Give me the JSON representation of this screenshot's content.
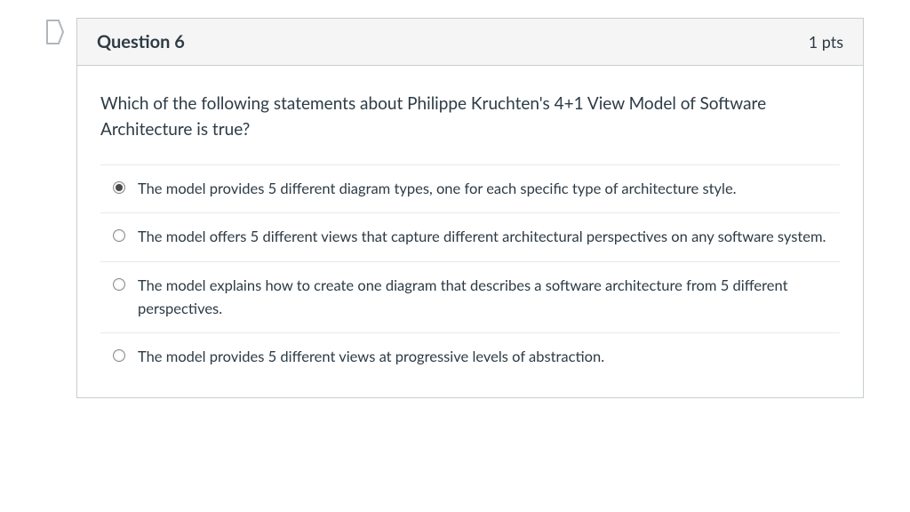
{
  "header": {
    "title": "Question 6",
    "points": "1 pts"
  },
  "prompt": "Which of the following statements about Philippe Kruchten's 4+1 View Model of Software Architecture is true?",
  "options": [
    {
      "text": "The model provides 5 different diagram types, one for each specific type of architecture style.",
      "selected": true
    },
    {
      "text": "The model offers 5 different views that capture different architectural perspectives on any software system.",
      "selected": false
    },
    {
      "text": "The model explains how to create one diagram that describes a software architecture from 5 different perspectives.",
      "selected": false
    },
    {
      "text": "The model provides 5 different views at progressive levels of abstraction.",
      "selected": false
    }
  ]
}
